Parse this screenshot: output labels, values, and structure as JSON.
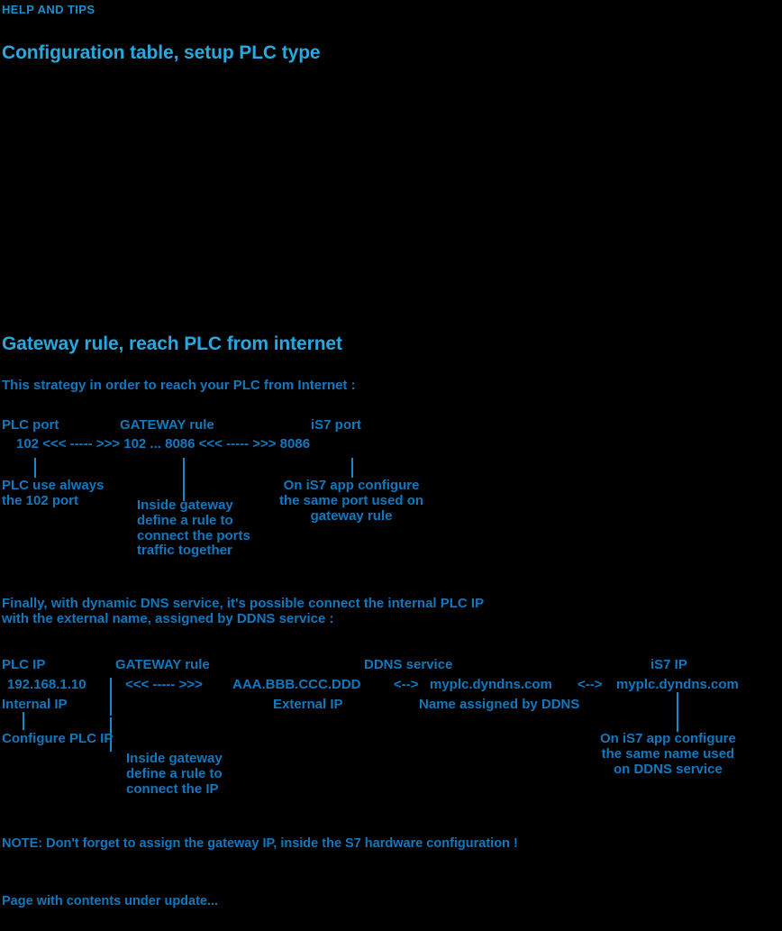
{
  "eyebrow": "HELP AND TIPS",
  "sections": [
    {
      "heading": "Configuration table, setup PLC type"
    },
    {
      "heading": "Gateway rule, reach PLC from internet",
      "intro": "This strategy in order to reach your PLC from Internet :",
      "diagram_ports": {
        "col_headers": [
          "PLC port",
          "GATEWAY rule",
          "iS7 port"
        ],
        "flow_line": "102 <<< ----- >>> 102 ... 8086 <<< ----- >>> 8086",
        "flow_parts": {
          "plc_port": "102",
          "arrow_left": "<<< ----- >>>",
          "gw_in": "102",
          "ellipsis": "...",
          "gw_out": "8086",
          "arrow_right": "<<< ----- >>>",
          "is7_port": "8086"
        },
        "annotations": [
          "PLC use always\nthe 102 port",
          "Inside gateway\ndefine a rule to\nconnect the ports\ntraffic together",
          "On iS7 app configure\nthe same port used on\ngateway rule"
        ]
      },
      "intro2": "Finally, with dynamic DNS service, it's possible connect the internal PLC IP\nwith the external name, assigned by DDNS service :",
      "diagram_ip": {
        "col_headers": [
          "PLC IP",
          "GATEWAY rule",
          "DDNS service",
          "iS7 IP"
        ],
        "flow_parts": {
          "plc_ip": "192.168.1.10",
          "arrow_left": "<<< ----- >>>",
          "external_ip": "AAA.BBB.CCC.DDD",
          "arrow_mid": "<-->",
          "ddns_name": "myplc.dyndns.com",
          "arrow_right": "<-->",
          "is7_name": "myplc.dyndns.com"
        },
        "sub_labels": [
          "Internal IP",
          "External IP",
          "Name assigned by DDNS"
        ],
        "annotations": [
          "Configure PLC IP",
          "Inside gateway\ndefine a rule to\nconnect the IP",
          "On iS7 app configure\nthe same name used\non DDNS service"
        ]
      },
      "note": "NOTE: Don't forget to assign the gateway IP, inside the S7 hardware configuration !"
    }
  ],
  "footer": "Page with contents under update...",
  "colors": {
    "background": "#000000",
    "heading": "#29a8e0",
    "body": "#1278be",
    "eyebrow": "#1a8fd0"
  }
}
